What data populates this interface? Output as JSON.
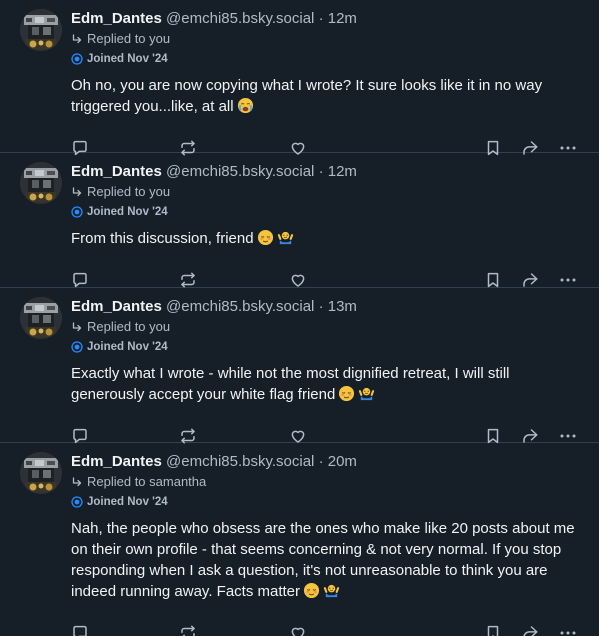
{
  "posts": [
    {
      "author": "Edm_Dantes",
      "handle": "@emchi85.bsky.social",
      "separator": "·",
      "time": "12m",
      "reply_to": "Replied to you",
      "joined": "Joined Nov '24",
      "text": "Oh no, you are now copying what I wrote? It sure looks like it in no way triggered you...like, at all",
      "emojis": [
        "crying-face-emoji"
      ]
    },
    {
      "author": "Edm_Dantes",
      "handle": "@emchi85.bsky.social",
      "separator": "·",
      "time": "12m",
      "reply_to": "Replied to you",
      "joined": "Joined Nov '24",
      "text": "From this discussion, friend",
      "emojis": [
        "relieved-face-emoji",
        "waving-hands-emoji"
      ]
    },
    {
      "author": "Edm_Dantes",
      "handle": "@emchi85.bsky.social",
      "separator": "·",
      "time": "13m",
      "reply_to": "Replied to you",
      "joined": "Joined Nov '24",
      "text": "Exactly what I wrote - while not the most dignified retreat, I will still generously accept your white flag friend",
      "emojis": [
        "relieved-face-emoji",
        "waving-hands-emoji"
      ]
    },
    {
      "author": "Edm_Dantes",
      "handle": "@emchi85.bsky.social",
      "separator": "·",
      "time": "20m",
      "reply_to": "Replied to samantha",
      "joined": "Joined Nov '24",
      "text": "Nah, the people who obsess are the ones who make like 20 posts about me on their own profile - that seems concerning & not very normal. If you stop responding when I ask a question, it's not unreasonable to think you are indeed running away. Facts matter",
      "emojis": [
        "relieved-face-emoji",
        "waving-hands-emoji"
      ]
    }
  ],
  "colors": {
    "background": "#161e27",
    "divider": "#2e4052",
    "text": "#f1f3f5",
    "muted": "#aebbc9",
    "badge": "#208bfe"
  },
  "icons": {
    "reply": "speech-bubble-icon",
    "repost": "repost-arrows-icon",
    "like": "heart-icon",
    "bookmark": "bookmark-icon",
    "share": "share-arrow-icon",
    "more": "ellipsis-icon",
    "replied": "reply-arrow-icon",
    "joined": "new-account-badge-icon"
  }
}
